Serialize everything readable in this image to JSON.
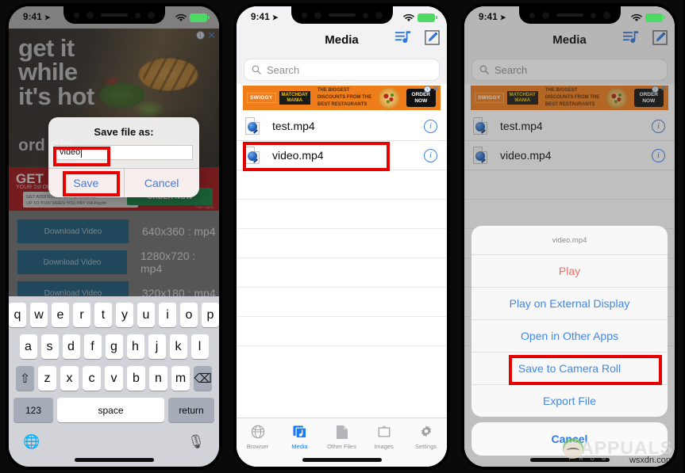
{
  "status_bar": {
    "time": "9:41",
    "location_icon": "location-arrow-icon",
    "wifi_icon": "wifi-icon",
    "battery_label": ""
  },
  "phone1": {
    "ad_hero": {
      "line1": "get it",
      "line2": "while",
      "line3": "it's hot",
      "sub": "ord                      ato",
      "info_icon": "ad-info-icon",
      "close_icon": "ad-close-icon"
    },
    "promo": {
      "headline": "GET",
      "subline": "YOUR 1st ORDER FREE",
      "cashback_line1": "GET ADDITIONAL 15% CASHBACK",
      "cashback_line2": "UP TO ₹100 WHEN YOU PAY VIA Paytm",
      "cta": "ORDER NOW",
      "fineprint": "*T&C Apply"
    },
    "downloads": [
      {
        "button": "Download Video",
        "resolution": "640x360 : mp4"
      },
      {
        "button": "Download Video",
        "resolution": "1280x720 : mp4"
      },
      {
        "button": "Download Video",
        "resolution": "320x180 : mp4"
      }
    ],
    "dialog": {
      "title": "Save file as:",
      "input_value": "video",
      "input_placeholder": "",
      "save_label": "Save",
      "cancel_label": "Cancel"
    },
    "keyboard": {
      "row1": [
        "q",
        "w",
        "e",
        "r",
        "t",
        "y",
        "u",
        "i",
        "o",
        "p"
      ],
      "row2": [
        "a",
        "s",
        "d",
        "f",
        "g",
        "h",
        "j",
        "k",
        "l"
      ],
      "row3": [
        "z",
        "x",
        "c",
        "v",
        "b",
        "n",
        "m"
      ],
      "shift": "shift-key",
      "backspace": "backspace-key",
      "numbers": "123",
      "space": "space",
      "return": "return",
      "globe": "globe-icon",
      "mic": "microphone-icon"
    }
  },
  "phone2": {
    "nav": {
      "title": "Media",
      "playlist_icon": "playlist-music-icon",
      "compose_icon": "compose-edit-icon"
    },
    "search": {
      "placeholder": "Search",
      "icon": "search-icon"
    },
    "ad": {
      "brand": "SWIGGY",
      "badge_line1": "MATCHDAY",
      "badge_line2": "MANIA",
      "text_line1": "THE BIGGEST",
      "text_line2": "DISCOUNTS FROM THE",
      "text_line3": "BEST RESTAURANTS",
      "cta_line1": "ORDER",
      "cta_line2": "NOW",
      "info_icon": "ad-info-icon",
      "close_icon": "ad-close-icon"
    },
    "files": [
      {
        "name": "test.mp4",
        "icon": "quicktime-file-icon",
        "info": "info-icon",
        "highlighted": false
      },
      {
        "name": "video.mp4",
        "icon": "quicktime-file-icon",
        "info": "info-icon",
        "highlighted": true
      }
    ],
    "tabs": [
      {
        "label": "Browser",
        "icon": "globe-icon",
        "active": false
      },
      {
        "label": "Media",
        "icon": "media-note-icon",
        "active": true
      },
      {
        "label": "Other Files",
        "icon": "document-icon",
        "active": false
      },
      {
        "label": "Images",
        "icon": "photo-icon",
        "active": false
      },
      {
        "label": "Settings",
        "icon": "gear-icon",
        "active": false
      }
    ]
  },
  "phone3": {
    "nav": {
      "title": "Media",
      "playlist_icon": "playlist-music-icon",
      "compose_icon": "compose-edit-icon"
    },
    "search": {
      "placeholder": "Search",
      "icon": "search-icon"
    },
    "files": [
      {
        "name": "test.mp4",
        "icon": "quicktime-file-icon",
        "info": "info-icon"
      },
      {
        "name": "video.mp4",
        "icon": "quicktime-file-icon",
        "info": "info-icon"
      }
    ],
    "action_sheet": {
      "header": "video.mp4",
      "items": [
        {
          "label": "Play",
          "style": "destructive",
          "highlighted": false
        },
        {
          "label": "Play on External Display",
          "style": "default",
          "highlighted": false
        },
        {
          "label": "Open in Other Apps",
          "style": "default",
          "highlighted": false
        },
        {
          "label": "Save to Camera Roll",
          "style": "default",
          "highlighted": true
        },
        {
          "label": "Export File",
          "style": "default",
          "highlighted": false
        }
      ],
      "cancel": "Cancel"
    }
  },
  "watermark": {
    "brand": "APPUALS",
    "tagline": "F R O M   T H E",
    "url": "wsxdn.com"
  },
  "colors": {
    "accent_blue": "#3f88e8",
    "destructive": "#e8706a",
    "highlight_red": "#e60000",
    "ad_orange": "#ef7d1a",
    "promo_red": "#b31217"
  }
}
